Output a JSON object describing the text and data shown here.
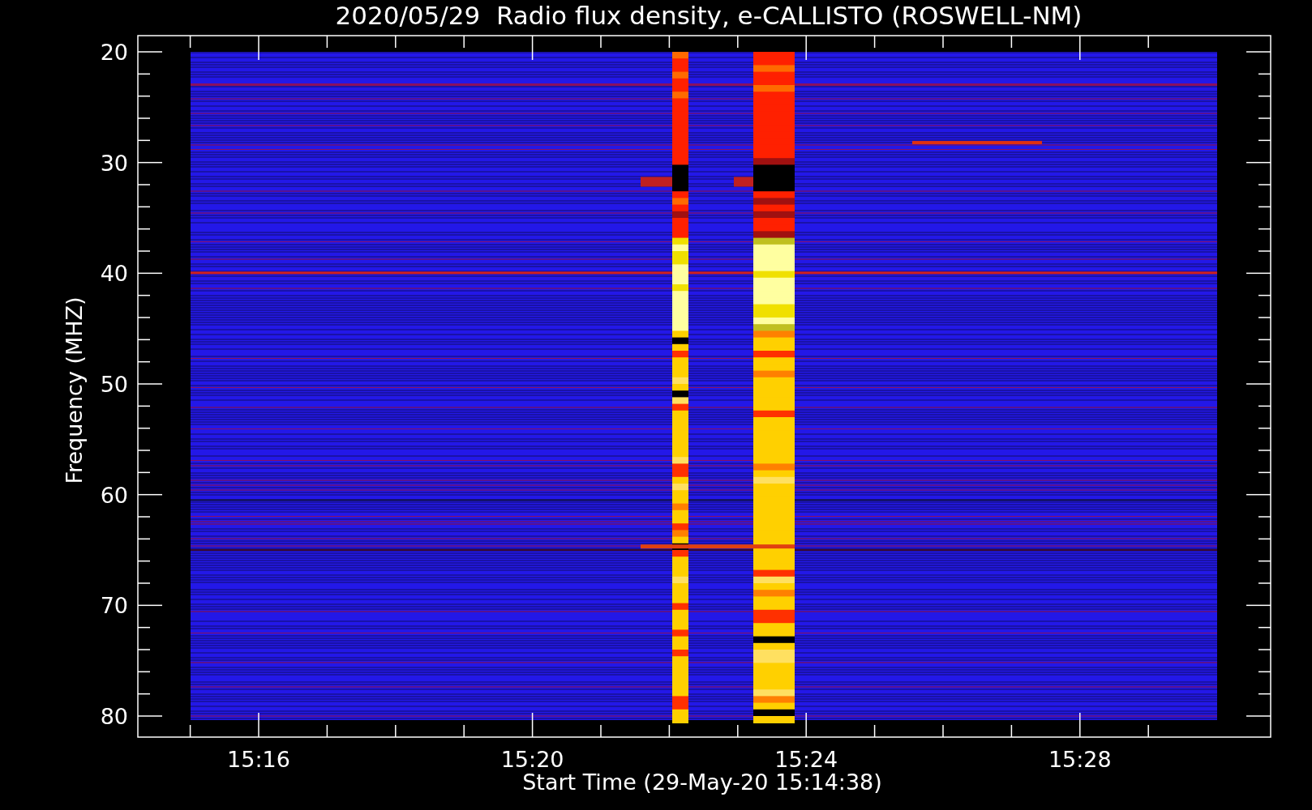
{
  "plot": {
    "title": "2020/05/29  Radio flux density, e-CALLISTO (ROSWELL-NM)",
    "xlabel": "Start Time (29-May-20 15:14:38)",
    "ylabel": "Frequency (MHZ)",
    "y_tick_labels": [
      "20",
      "30",
      "40",
      "50",
      "60",
      "70",
      "80"
    ],
    "x_tick_labels": [
      "15:16",
      "15:20",
      "15:24",
      "15:28"
    ]
  }
}
